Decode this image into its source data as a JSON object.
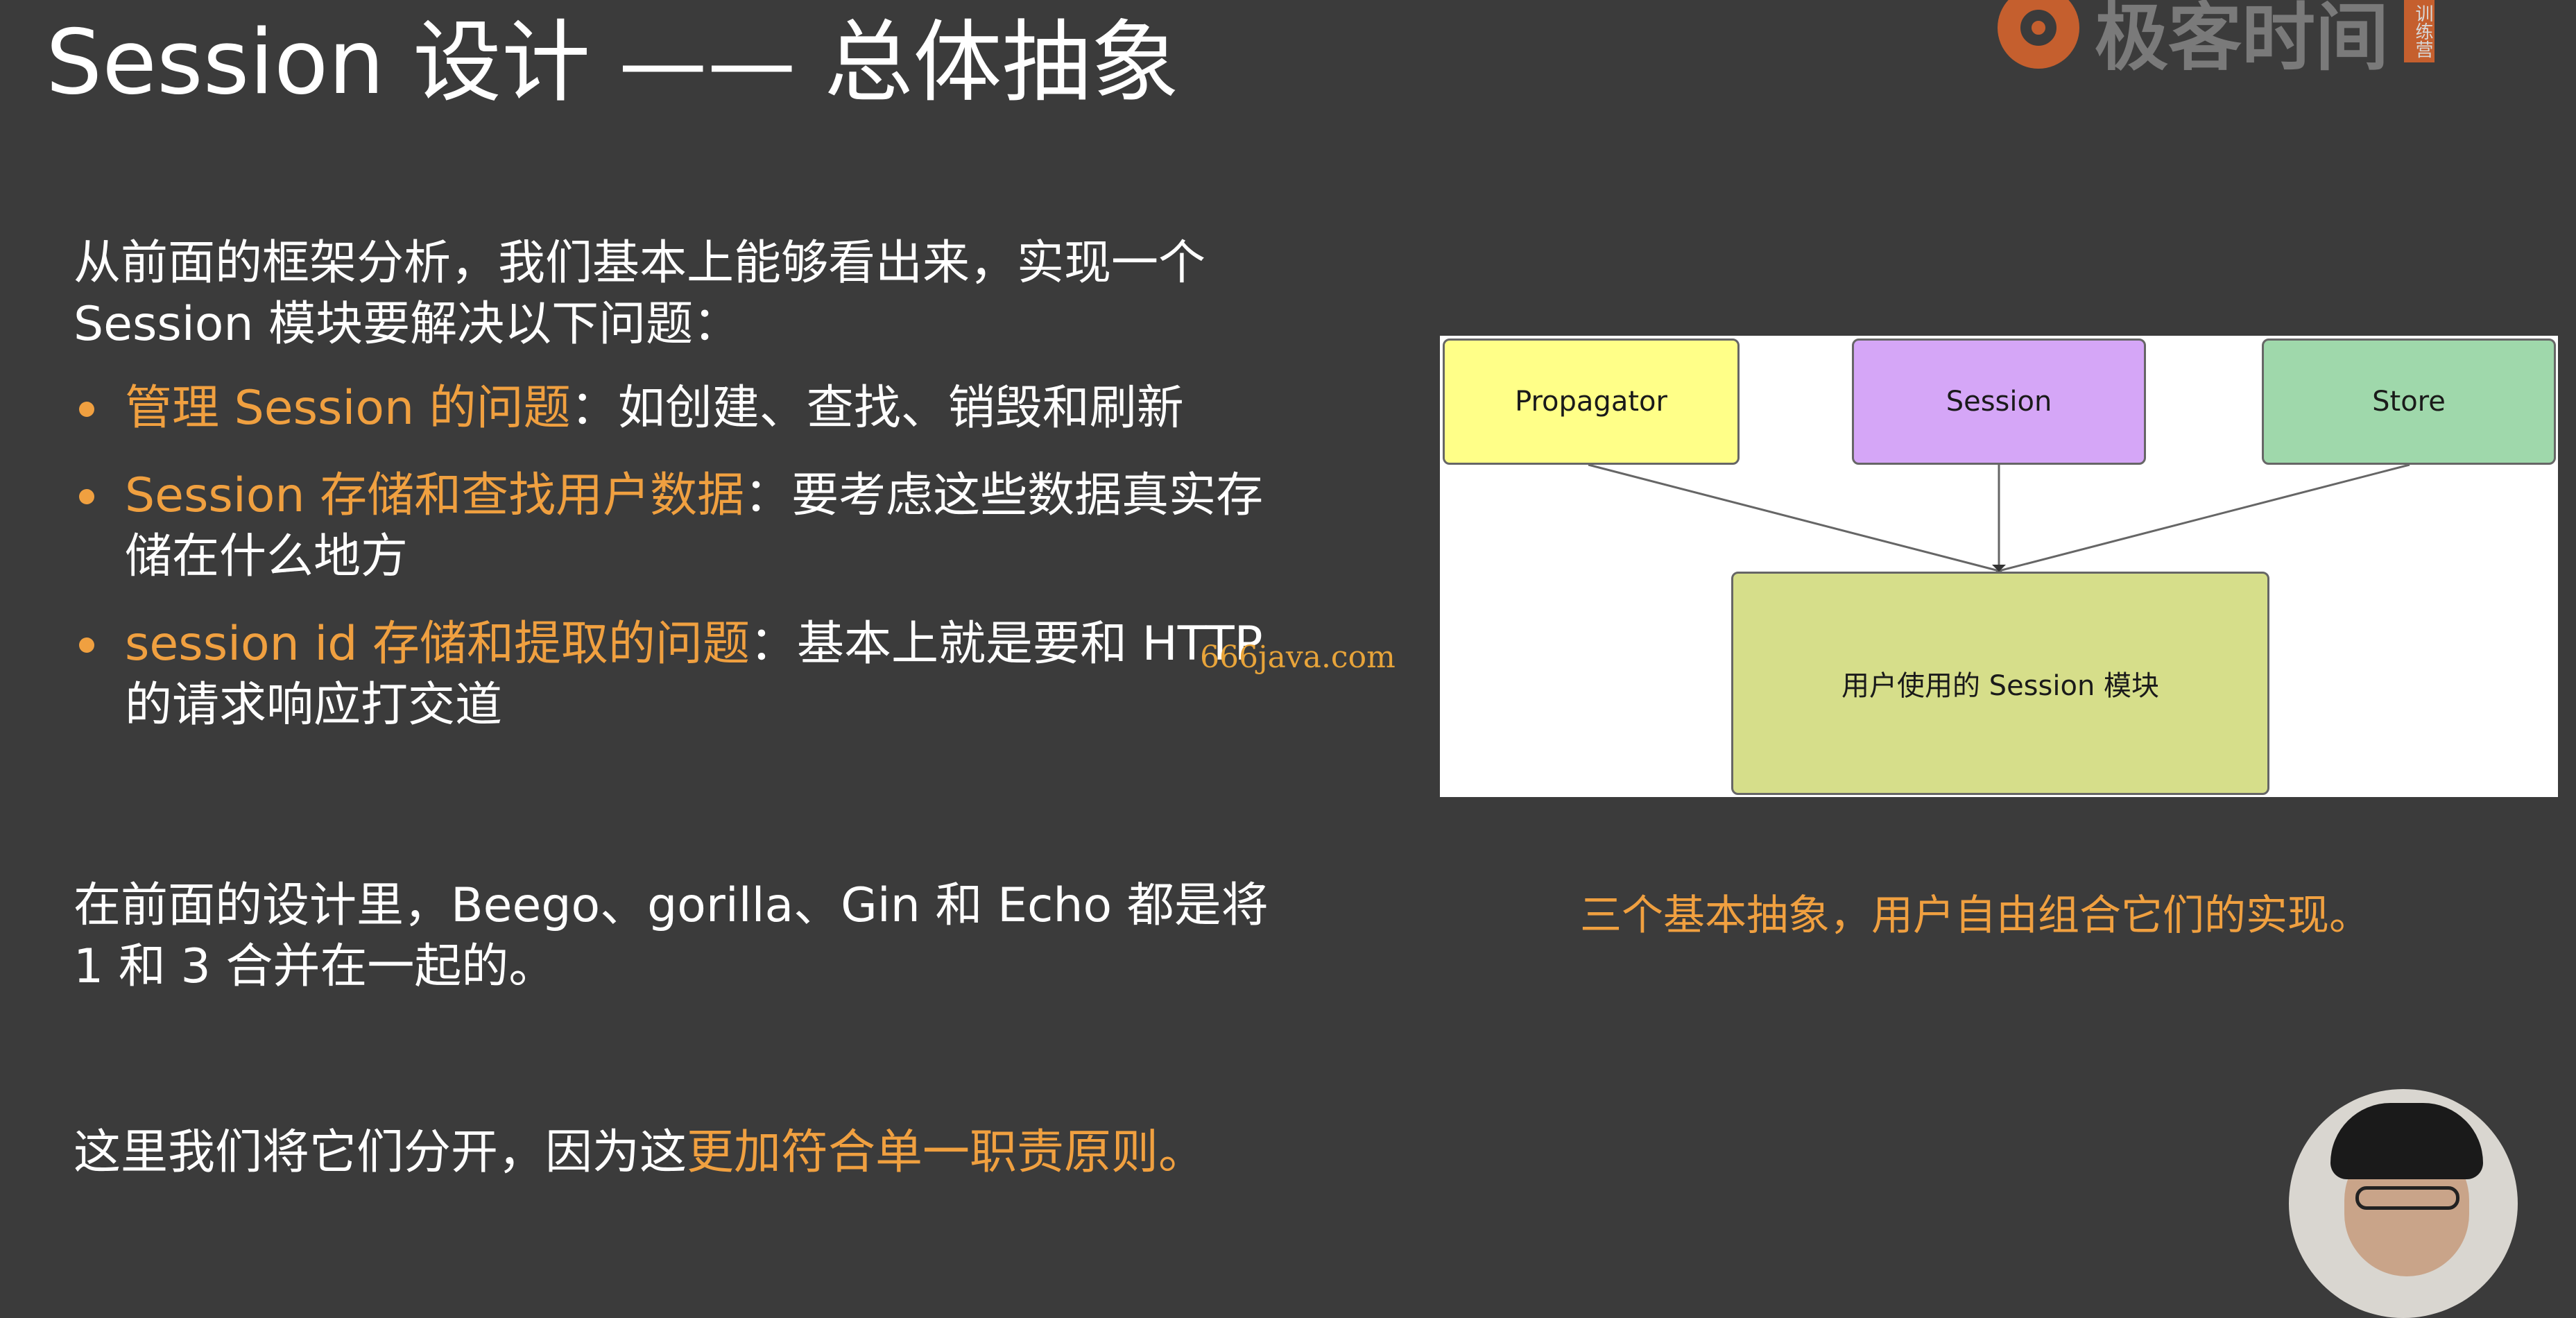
{
  "slide": {
    "title": "Session 设计 —— 总体抽象",
    "intro_line1": "从前面的框架分析，我们基本上能够看出来，实现一个",
    "intro_line2": "Session 模块要解决以下问题：",
    "bullets": [
      {
        "highlight": "管理 Session 的问题",
        "rest": "：如创建、查找、销毁和刷新",
        "rest2": ""
      },
      {
        "highlight": "Session 存储和查找用户数据",
        "rest": "：要考虑这些数据真实存",
        "rest2": "储在什么地方"
      },
      {
        "highlight": "session id 存储和提取的问题",
        "rest": "：基本上就是要和 HTTP",
        "rest2": "的请求响应打交道"
      }
    ],
    "note_line1": "在前面的设计里，Beego、gorilla、Gin 和 Echo 都是将",
    "note_line2": "1 和 3 合并在一起的。",
    "conclusion_plain": "这里我们将它们分开，因为这",
    "conclusion_highlight": "更加符合单一职责原则。",
    "watermark": "666java.com"
  },
  "logo": {
    "text": "极客时间",
    "badge": "训练营",
    "accent": "#e8692c"
  },
  "diagram": {
    "boxes": [
      {
        "label": "Propagator",
        "color": "#ffff88"
      },
      {
        "label": "Session",
        "color": "#d5a6f7"
      },
      {
        "label": "Store",
        "color": "#9fd8ab"
      }
    ],
    "target": {
      "label": "用户使用的 Session 模块",
      "color": "#d6de8a"
    }
  },
  "caption": "三个基本抽象，用户自由组合它们的实现。",
  "colors": {
    "background": "#3b3b3b",
    "highlight": "#f0a040"
  }
}
